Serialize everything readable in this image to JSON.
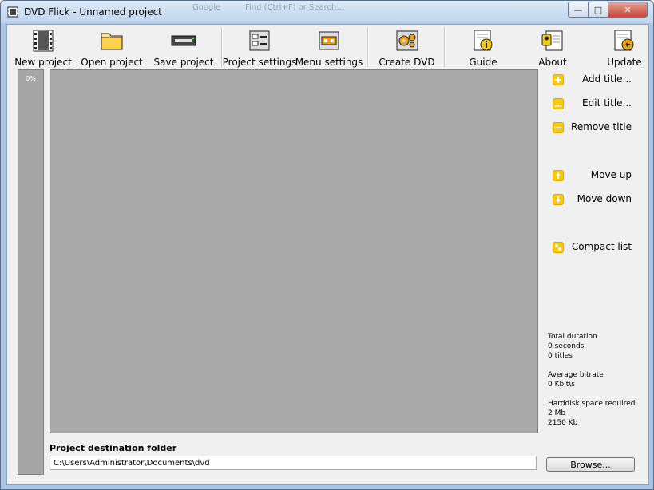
{
  "window": {
    "title": "DVD Flick - Unnamed project"
  },
  "taskbar_ghost": {
    "item1": "Google",
    "item2": "Find (Ctrl+F) or Search..."
  },
  "toolbar": {
    "new_project": "New project",
    "open_project": "Open project",
    "save_project": "Save project",
    "project_settings": "Project settings",
    "menu_settings": "Menu settings",
    "create_dvd": "Create DVD",
    "guide": "Guide",
    "about": "About",
    "update": "Update"
  },
  "progress": {
    "label": "0%",
    "value": 0
  },
  "actions": {
    "add_title": "Add title...",
    "edit_title": "Edit title...",
    "remove_title": "Remove title",
    "move_up": "Move up",
    "move_down": "Move down",
    "compact_list": "Compact list"
  },
  "stats": {
    "total_duration_label": "Total duration",
    "total_duration_value": "0 seconds",
    "titles_count": "0 titles",
    "avg_bitrate_label": "Average bitrate",
    "avg_bitrate_value": "0 Kbit\\s",
    "disk_space_label": "Harddisk space required",
    "disk_space_mb": "2 Mb",
    "disk_space_kb": "2150 Kb"
  },
  "destination": {
    "label": "Project destination folder",
    "path": "C:\\Users\\Administrator\\Documents\\dvd",
    "browse_label": "Browse..."
  },
  "colors": {
    "accent_yellow": "#f7c911",
    "list_gray": "#a8a8a8",
    "window_frame": "#a9c6e6"
  },
  "icons": {
    "new_project": "film-icon",
    "open_project": "folder-icon",
    "save_project": "save-icon",
    "project_settings": "settings-icon",
    "menu_settings": "menu-icon",
    "create_dvd": "gears-icon",
    "guide": "info-icon",
    "about": "about-icon",
    "update": "update-icon"
  }
}
